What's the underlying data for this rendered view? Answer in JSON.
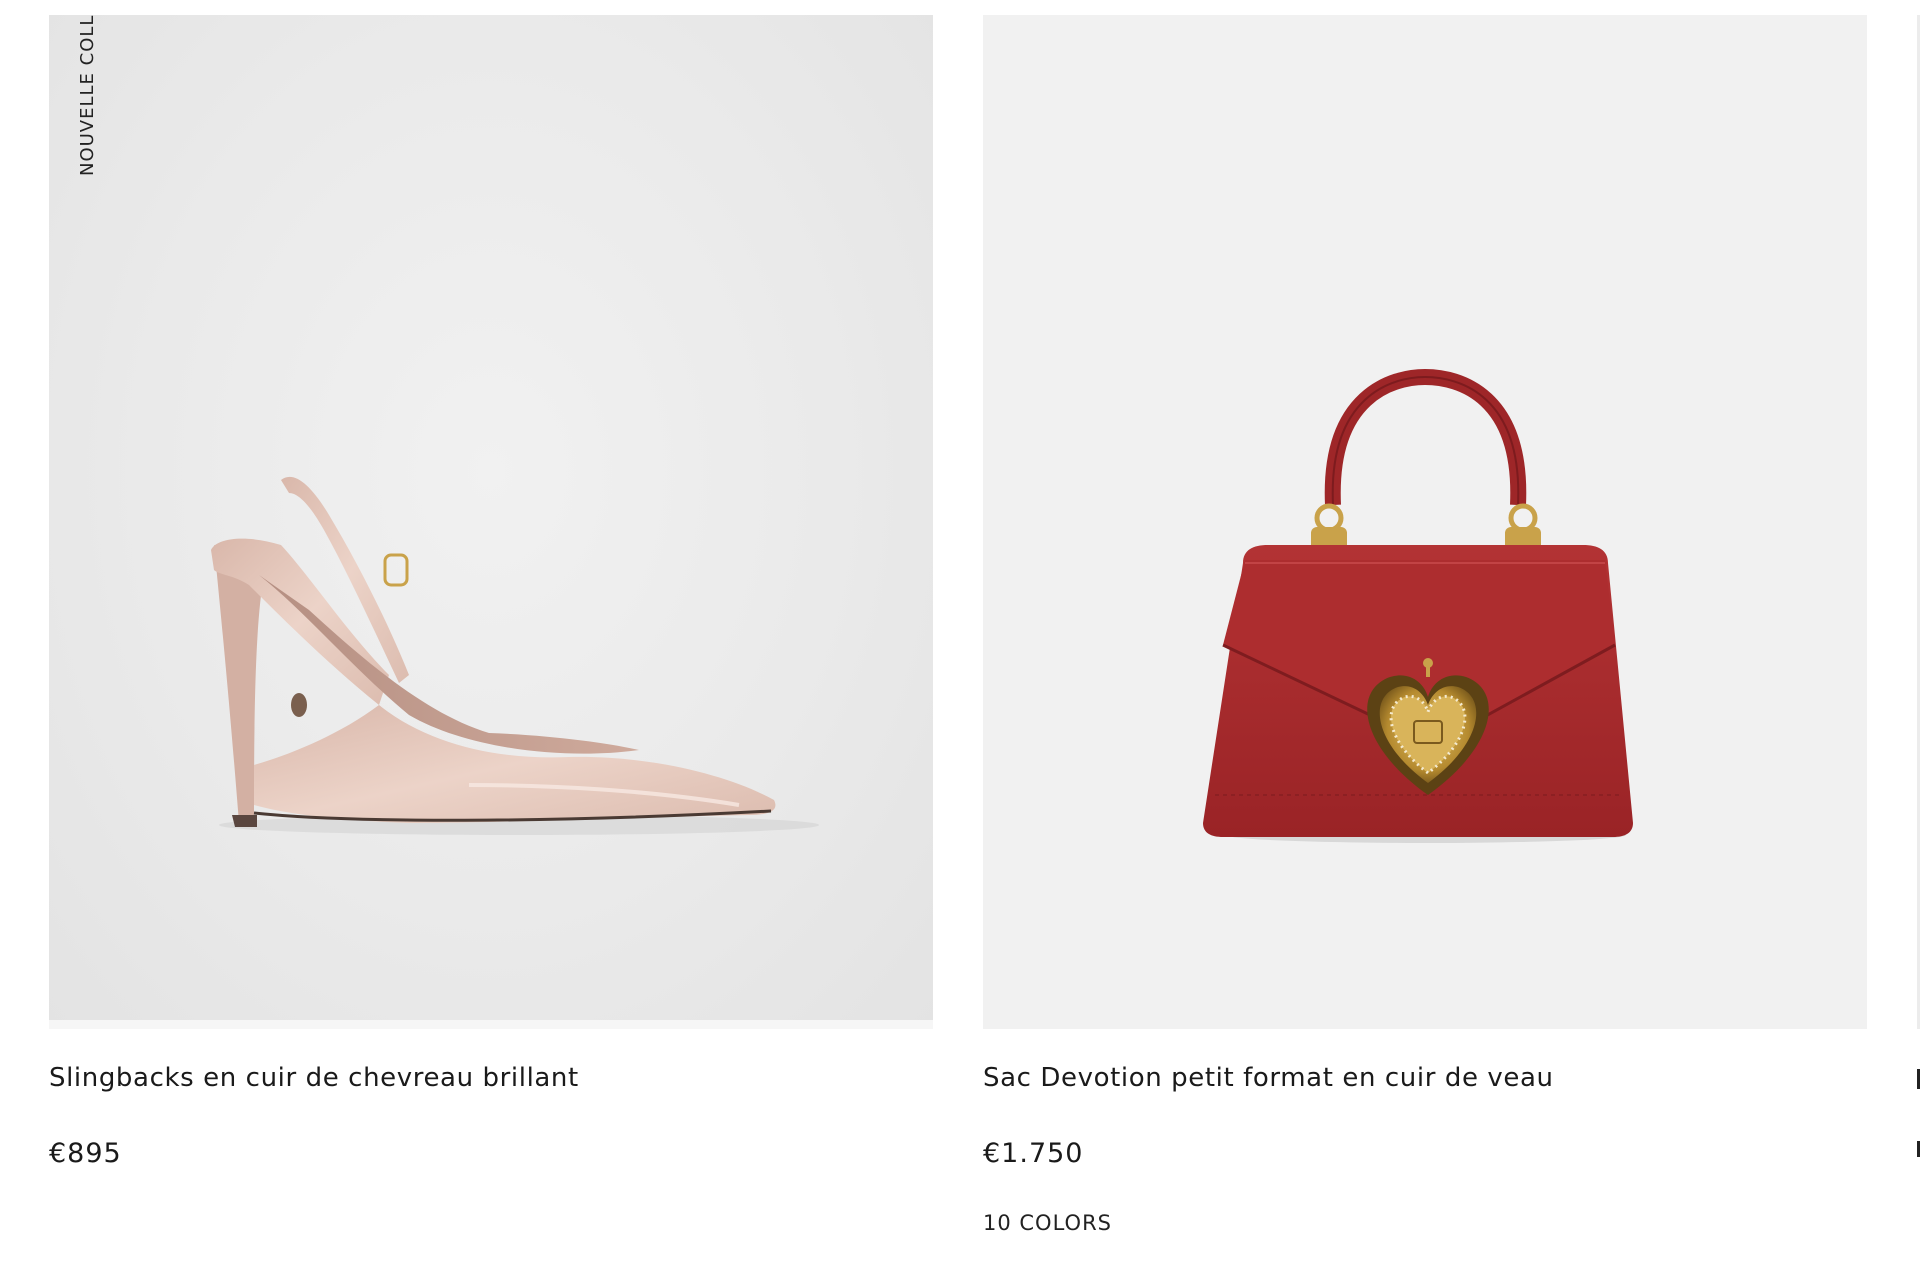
{
  "products": [
    {
      "tag": "NOUVELLE COLL",
      "name": "Slingbacks en cuir de chevreau brillant",
      "price": "€895",
      "image_icon": "slingback-shoe-image",
      "colors": {
        "background": "#ebebeb",
        "product": "#e6c9bd"
      }
    },
    {
      "name": "Sac Devotion petit format en cuir de veau",
      "price": "€1.750",
      "colors_label": "10 COLORS",
      "image_icon": "devotion-bag-image",
      "colors": {
        "background": "#f1f1f1",
        "product": "#a8282b",
        "hardware": "#c9a24a"
      }
    }
  ]
}
